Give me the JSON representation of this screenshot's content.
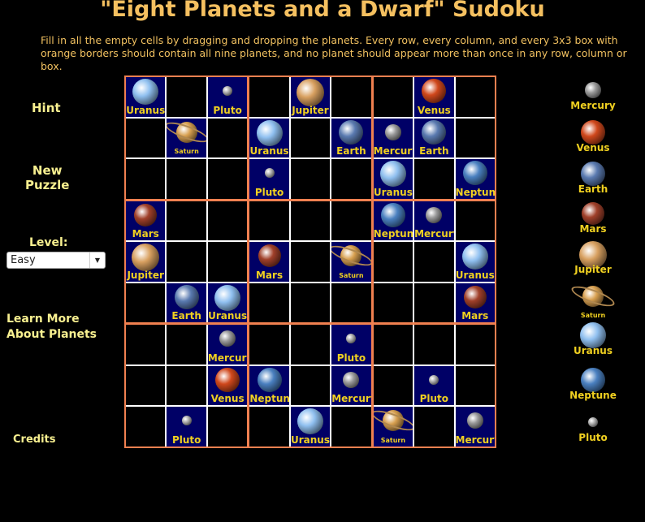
{
  "title": "\"Eight Planets and a Dwarf\" Sudoku",
  "instructions": "Fill in all the empty cells by dragging and dropping the planets. Every row,  every column,  and every 3x3 box with orange borders should contain all nine planets, and no planet should appear more than once in any row, column or box.",
  "sidebar": {
    "hint": "Hint",
    "new_puzzle_1": "New",
    "new_puzzle_2": "Puzzle",
    "level_label": "Level:",
    "level_value": "Easy",
    "learn_1": "Learn More",
    "learn_2": "About Planets",
    "credits": "Credits"
  },
  "colors": {
    "border": "#f08050",
    "cell_filled": "#000066",
    "label": "#f0d020"
  },
  "planets": {
    "Mercury": {
      "color": "#9a9a9a",
      "size": 20
    },
    "Venus": {
      "color": "#d0481c",
      "size": 30
    },
    "Earth": {
      "color": "#5a7ab0",
      "size": 30
    },
    "Mars": {
      "color": "#a0402a",
      "size": 28
    },
    "Jupiter": {
      "color": "#d8a060",
      "size": 34
    },
    "Saturn": {
      "color": "#d8a050",
      "size": 26
    },
    "Uranus": {
      "color": "#90c0f0",
      "size": 32
    },
    "Neptune": {
      "color": "#4a80c0",
      "size": 30
    },
    "Pluto": {
      "color": "#b0b0b0",
      "size": 12
    }
  },
  "palette": [
    "Mercury",
    "Venus",
    "Earth",
    "Mars",
    "Jupiter",
    "Saturn",
    "Uranus",
    "Neptune",
    "Pluto"
  ],
  "grid": [
    [
      "Uranus",
      "",
      "Pluto",
      "",
      "Jupiter",
      "",
      "",
      "Venus",
      ""
    ],
    [
      "",
      "Saturn",
      "",
      "Uranus",
      "",
      "Earth",
      "Mercury",
      "Earth",
      ""
    ],
    [
      "",
      "",
      "",
      "Pluto",
      "",
      "",
      "Uranus",
      "",
      "Neptune"
    ],
    [
      "Mars",
      "",
      "",
      "",
      "",
      "",
      "Neptune",
      "Mercury",
      ""
    ],
    [
      "Jupiter",
      "",
      "",
      "Mars",
      "",
      "Saturn",
      "",
      "",
      "Uranus"
    ],
    [
      "",
      "Earth",
      "Uranus",
      "",
      "",
      "",
      "",
      "",
      "Mars"
    ],
    [
      "",
      "",
      "Mercury",
      "",
      "",
      "Pluto",
      "",
      "",
      ""
    ],
    [
      "",
      "",
      "Venus",
      "Neptune",
      "",
      "Mercury",
      "",
      "Pluto",
      ""
    ],
    [
      "",
      "Pluto",
      "",
      "",
      "Uranus",
      "",
      "Saturn",
      "",
      "Mercury"
    ]
  ]
}
